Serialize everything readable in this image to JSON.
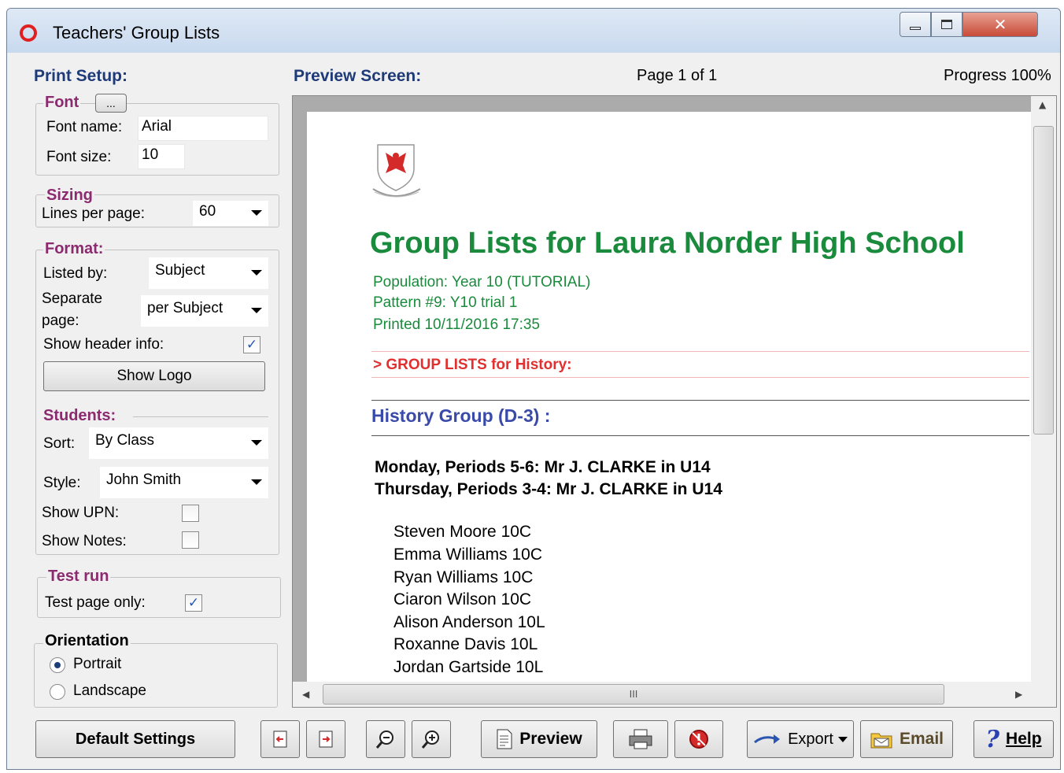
{
  "window": {
    "title": "Teachers' Group Lists"
  },
  "print_setup": {
    "label": "Print Setup:",
    "font": {
      "group_label": "Font",
      "browse_label": "...",
      "name_label": "Font name:",
      "name_value": "Arial",
      "size_label": "Font size:",
      "size_value": "10"
    },
    "sizing": {
      "group_label": "Sizing",
      "lines_label": "Lines per page:",
      "lines_value": "60"
    },
    "format": {
      "group_label": "Format:",
      "listed_by_label": "Listed by:",
      "listed_by_value": "Subject",
      "separate_label_1": "Separate",
      "separate_label_2": "page:",
      "separate_value": "per Subject",
      "show_header_label": "Show header info:",
      "show_header_checked": true,
      "show_logo_label": "Show Logo"
    },
    "students": {
      "group_label": "Students:",
      "sort_label": "Sort:",
      "sort_value": "By Class",
      "style_label": "Style:",
      "style_value": "John Smith",
      "show_upn_label": "Show UPN:",
      "show_upn_checked": false,
      "show_notes_label": "Show Notes:",
      "show_notes_checked": false
    },
    "test_run": {
      "group_label": "Test run",
      "test_page_label": "Test page only:",
      "test_page_checked": true
    },
    "orientation": {
      "group_label": "Orientation",
      "portrait_label": "Portrait",
      "landscape_label": "Landscape",
      "selected": "Portrait"
    }
  },
  "preview": {
    "label": "Preview Screen:",
    "page_indicator": "Page 1 of 1",
    "progress": "Progress 100%",
    "hscroll_grip": "III",
    "document": {
      "title": "Group Lists for Laura Norder High School",
      "population": "Population:  Year 10    (TUTORIAL)",
      "pattern": "Pattern #9: Y10  trial 1",
      "printed": "Printed   10/11/2016   17:35",
      "group_header": "> GROUP LISTS for History:",
      "history_group": "History Group (D-3)    :",
      "schedule": [
        "Monday, Periods 5-6:   Mr J. CLARKE  in U14",
        "Thursday, Periods 3-4:   Mr J. CLARKE  in U14"
      ],
      "students": [
        "Steven Moore  10C",
        "Emma Williams 10C",
        "Ryan Williams  10C",
        "Ciaron Wilson  10C",
        "Alison Anderson  10L",
        "Roxanne Davis  10L",
        "Jordan Gartside  10L"
      ]
    }
  },
  "toolbar": {
    "default_settings": "Default Settings",
    "preview": "Preview",
    "export": "Export",
    "email": "Email",
    "help": "Help"
  },
  "colors": {
    "accent_label": "#8b2a6e",
    "heading_blue": "#1f3a78",
    "doc_green": "#1a8a3c",
    "doc_red": "#e03030",
    "doc_blue": "#3a4aa8"
  }
}
